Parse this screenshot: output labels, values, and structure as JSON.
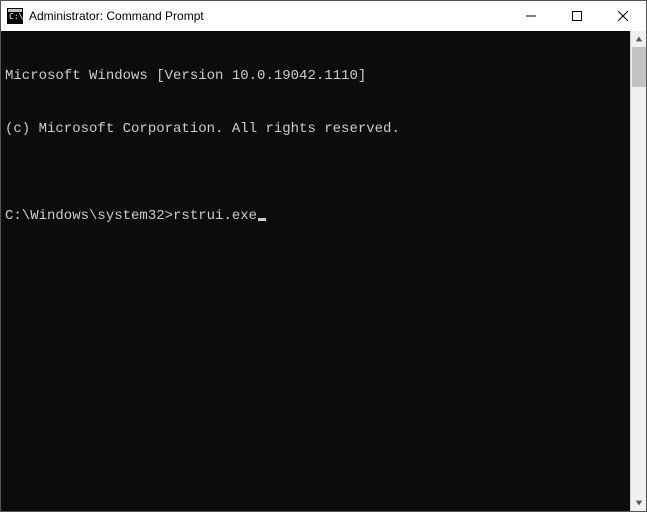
{
  "window": {
    "title": "Administrator: Command Prompt"
  },
  "terminal": {
    "line1": "Microsoft Windows [Version 10.0.19042.1110]",
    "line2": "(c) Microsoft Corporation. All rights reserved.",
    "blank": "",
    "prompt": "C:\\Windows\\system32>",
    "command": "rstrui.exe"
  }
}
